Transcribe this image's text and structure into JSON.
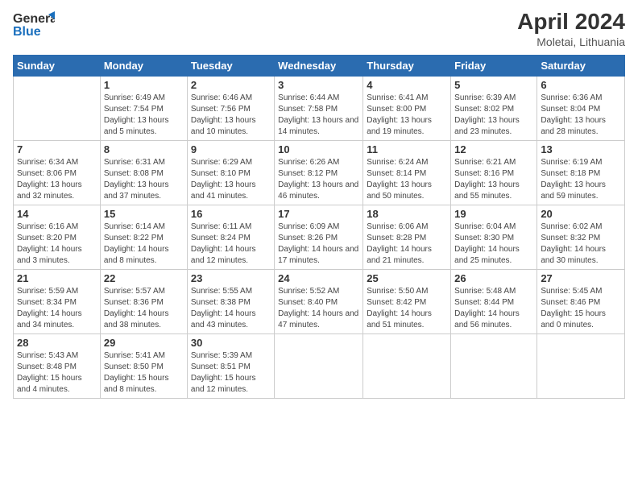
{
  "header": {
    "logo_general": "General",
    "logo_blue": "Blue",
    "main_title": "April 2024",
    "subtitle": "Moletai, Lithuania"
  },
  "weekdays": [
    "Sunday",
    "Monday",
    "Tuesday",
    "Wednesday",
    "Thursday",
    "Friday",
    "Saturday"
  ],
  "weeks": [
    [
      {
        "num": "",
        "sunrise": "",
        "sunset": "",
        "daylight": ""
      },
      {
        "num": "1",
        "sunrise": "Sunrise: 6:49 AM",
        "sunset": "Sunset: 7:54 PM",
        "daylight": "Daylight: 13 hours and 5 minutes."
      },
      {
        "num": "2",
        "sunrise": "Sunrise: 6:46 AM",
        "sunset": "Sunset: 7:56 PM",
        "daylight": "Daylight: 13 hours and 10 minutes."
      },
      {
        "num": "3",
        "sunrise": "Sunrise: 6:44 AM",
        "sunset": "Sunset: 7:58 PM",
        "daylight": "Daylight: 13 hours and 14 minutes."
      },
      {
        "num": "4",
        "sunrise": "Sunrise: 6:41 AM",
        "sunset": "Sunset: 8:00 PM",
        "daylight": "Daylight: 13 hours and 19 minutes."
      },
      {
        "num": "5",
        "sunrise": "Sunrise: 6:39 AM",
        "sunset": "Sunset: 8:02 PM",
        "daylight": "Daylight: 13 hours and 23 minutes."
      },
      {
        "num": "6",
        "sunrise": "Sunrise: 6:36 AM",
        "sunset": "Sunset: 8:04 PM",
        "daylight": "Daylight: 13 hours and 28 minutes."
      }
    ],
    [
      {
        "num": "7",
        "sunrise": "Sunrise: 6:34 AM",
        "sunset": "Sunset: 8:06 PM",
        "daylight": "Daylight: 13 hours and 32 minutes."
      },
      {
        "num": "8",
        "sunrise": "Sunrise: 6:31 AM",
        "sunset": "Sunset: 8:08 PM",
        "daylight": "Daylight: 13 hours and 37 minutes."
      },
      {
        "num": "9",
        "sunrise": "Sunrise: 6:29 AM",
        "sunset": "Sunset: 8:10 PM",
        "daylight": "Daylight: 13 hours and 41 minutes."
      },
      {
        "num": "10",
        "sunrise": "Sunrise: 6:26 AM",
        "sunset": "Sunset: 8:12 PM",
        "daylight": "Daylight: 13 hours and 46 minutes."
      },
      {
        "num": "11",
        "sunrise": "Sunrise: 6:24 AM",
        "sunset": "Sunset: 8:14 PM",
        "daylight": "Daylight: 13 hours and 50 minutes."
      },
      {
        "num": "12",
        "sunrise": "Sunrise: 6:21 AM",
        "sunset": "Sunset: 8:16 PM",
        "daylight": "Daylight: 13 hours and 55 minutes."
      },
      {
        "num": "13",
        "sunrise": "Sunrise: 6:19 AM",
        "sunset": "Sunset: 8:18 PM",
        "daylight": "Daylight: 13 hours and 59 minutes."
      }
    ],
    [
      {
        "num": "14",
        "sunrise": "Sunrise: 6:16 AM",
        "sunset": "Sunset: 8:20 PM",
        "daylight": "Daylight: 14 hours and 3 minutes."
      },
      {
        "num": "15",
        "sunrise": "Sunrise: 6:14 AM",
        "sunset": "Sunset: 8:22 PM",
        "daylight": "Daylight: 14 hours and 8 minutes."
      },
      {
        "num": "16",
        "sunrise": "Sunrise: 6:11 AM",
        "sunset": "Sunset: 8:24 PM",
        "daylight": "Daylight: 14 hours and 12 minutes."
      },
      {
        "num": "17",
        "sunrise": "Sunrise: 6:09 AM",
        "sunset": "Sunset: 8:26 PM",
        "daylight": "Daylight: 14 hours and 17 minutes."
      },
      {
        "num": "18",
        "sunrise": "Sunrise: 6:06 AM",
        "sunset": "Sunset: 8:28 PM",
        "daylight": "Daylight: 14 hours and 21 minutes."
      },
      {
        "num": "19",
        "sunrise": "Sunrise: 6:04 AM",
        "sunset": "Sunset: 8:30 PM",
        "daylight": "Daylight: 14 hours and 25 minutes."
      },
      {
        "num": "20",
        "sunrise": "Sunrise: 6:02 AM",
        "sunset": "Sunset: 8:32 PM",
        "daylight": "Daylight: 14 hours and 30 minutes."
      }
    ],
    [
      {
        "num": "21",
        "sunrise": "Sunrise: 5:59 AM",
        "sunset": "Sunset: 8:34 PM",
        "daylight": "Daylight: 14 hours and 34 minutes."
      },
      {
        "num": "22",
        "sunrise": "Sunrise: 5:57 AM",
        "sunset": "Sunset: 8:36 PM",
        "daylight": "Daylight: 14 hours and 38 minutes."
      },
      {
        "num": "23",
        "sunrise": "Sunrise: 5:55 AM",
        "sunset": "Sunset: 8:38 PM",
        "daylight": "Daylight: 14 hours and 43 minutes."
      },
      {
        "num": "24",
        "sunrise": "Sunrise: 5:52 AM",
        "sunset": "Sunset: 8:40 PM",
        "daylight": "Daylight: 14 hours and 47 minutes."
      },
      {
        "num": "25",
        "sunrise": "Sunrise: 5:50 AM",
        "sunset": "Sunset: 8:42 PM",
        "daylight": "Daylight: 14 hours and 51 minutes."
      },
      {
        "num": "26",
        "sunrise": "Sunrise: 5:48 AM",
        "sunset": "Sunset: 8:44 PM",
        "daylight": "Daylight: 14 hours and 56 minutes."
      },
      {
        "num": "27",
        "sunrise": "Sunrise: 5:45 AM",
        "sunset": "Sunset: 8:46 PM",
        "daylight": "Daylight: 15 hours and 0 minutes."
      }
    ],
    [
      {
        "num": "28",
        "sunrise": "Sunrise: 5:43 AM",
        "sunset": "Sunset: 8:48 PM",
        "daylight": "Daylight: 15 hours and 4 minutes."
      },
      {
        "num": "29",
        "sunrise": "Sunrise: 5:41 AM",
        "sunset": "Sunset: 8:50 PM",
        "daylight": "Daylight: 15 hours and 8 minutes."
      },
      {
        "num": "30",
        "sunrise": "Sunrise: 5:39 AM",
        "sunset": "Sunset: 8:51 PM",
        "daylight": "Daylight: 15 hours and 12 minutes."
      },
      {
        "num": "",
        "sunrise": "",
        "sunset": "",
        "daylight": ""
      },
      {
        "num": "",
        "sunrise": "",
        "sunset": "",
        "daylight": ""
      },
      {
        "num": "",
        "sunrise": "",
        "sunset": "",
        "daylight": ""
      },
      {
        "num": "",
        "sunrise": "",
        "sunset": "",
        "daylight": ""
      }
    ]
  ]
}
